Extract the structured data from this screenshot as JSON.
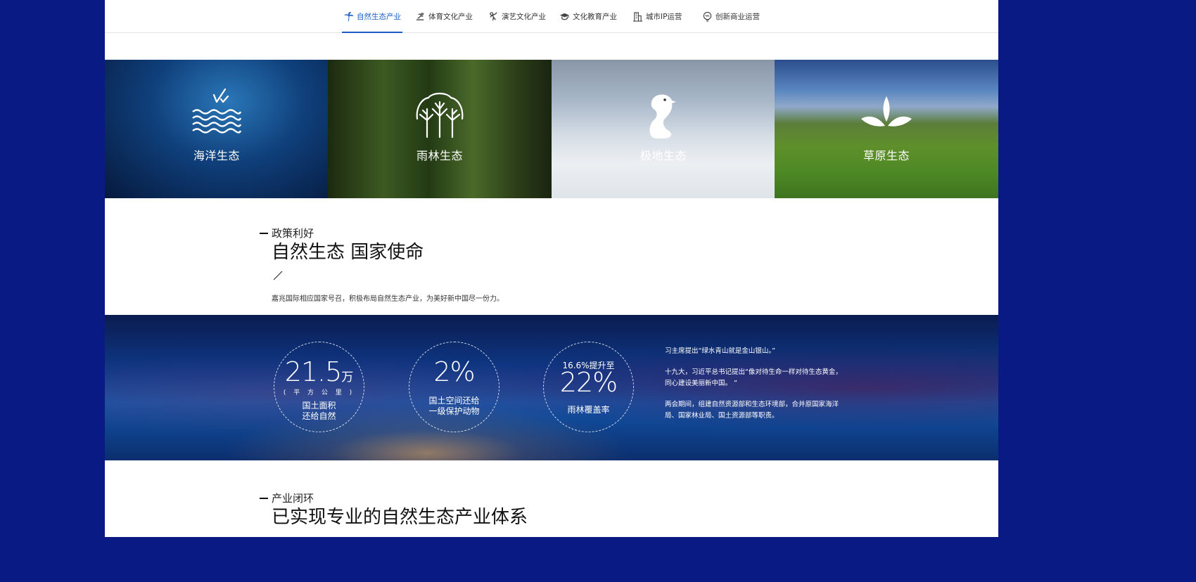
{
  "nav": {
    "items": [
      {
        "label": "自然生态产业",
        "icon": "palm-tree-icon",
        "active": true
      },
      {
        "label": "体育文化产业",
        "icon": "runner-icon",
        "active": false
      },
      {
        "label": "演艺文化产业",
        "icon": "performer-icon",
        "active": false
      },
      {
        "label": "文化教育产业",
        "icon": "graduation-cap-icon",
        "active": false
      },
      {
        "label": "城市IP运营",
        "icon": "building-icon",
        "active": false
      },
      {
        "label": "创新商业运营",
        "icon": "lightbulb-icon",
        "active": false
      }
    ],
    "accent_color": "#1c5fc6"
  },
  "tiles": [
    {
      "label": "海洋生态",
      "icon": "waves-birds-icon"
    },
    {
      "label": "雨林生态",
      "icon": "trees-icon"
    },
    {
      "label": "极地生态",
      "icon": "penguin-icon"
    },
    {
      "label": "草原生态",
      "icon": "grass-leaves-icon"
    }
  ],
  "policy": {
    "kicker": "政策利好",
    "headline": "自然生态 国家使命",
    "blurb": "嘉兆国际相应国家号召，积极布局自然生态产业，为美好新中国尽一份力。"
  },
  "stats": [
    {
      "value": "21.5",
      "unit": "万",
      "sub": "( 平 方 公 里 )",
      "caption_line1": "国土面积",
      "caption_line2": "还给自然"
    },
    {
      "value": "2%",
      "caption_line1": "国土空间还给",
      "caption_line2": "一级保护动物"
    },
    {
      "top": "16.6%提升至",
      "value": "22%",
      "caption_line1": "雨林覆盖率"
    }
  ],
  "quotes": [
    "习主席提出“绿水青山就是金山银山。”",
    "十九大，习近平总书记提出“像对待生命一样对待生态黄金，同心建设美丽新中国。 ”",
    "两会期间，组建自然资源部和生态环境部，合并原国家海洋局、国家林业局、国土资源部等职责。"
  ],
  "loop": {
    "kicker": "产业闭环",
    "headline": "已实现专业的自然生态产业体系"
  },
  "colors": {
    "page_background": "#0a1a85",
    "band_base": "#0f3a8a"
  }
}
